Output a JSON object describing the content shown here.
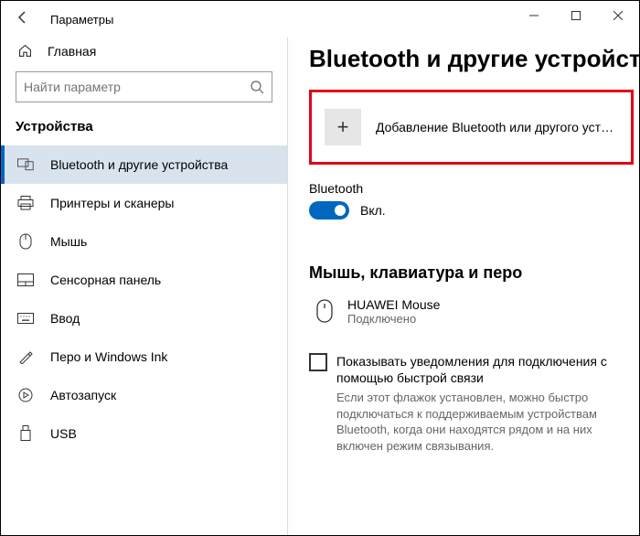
{
  "window": {
    "title": "Параметры"
  },
  "sidebar": {
    "home": "Главная",
    "searchPlaceholder": "Найти параметр",
    "category": "Устройства",
    "items": [
      {
        "label": "Bluetooth и другие устройства"
      },
      {
        "label": "Принтеры и сканеры"
      },
      {
        "label": "Мышь"
      },
      {
        "label": "Сенсорная панель"
      },
      {
        "label": "Ввод"
      },
      {
        "label": "Перо и Windows Ink"
      },
      {
        "label": "Автозапуск"
      },
      {
        "label": "USB"
      }
    ]
  },
  "page": {
    "title": "Bluetooth и другие устройства",
    "addDevice": "Добавление Bluetooth или другого устройс...",
    "btLabel": "Bluetooth",
    "btState": "Вкл.",
    "devicesHeading": "Мышь, клавиатура и перо",
    "device": {
      "name": "HUAWEI  Mouse",
      "status": "Подключено"
    },
    "quickPair": "Показывать уведомления для подключения с помощью быстрой связи",
    "quickPairHint": "Если этот флажок установлен, можно быстро подключаться к поддерживаемым устройствам Bluetooth, когда они находятся рядом и на них включен режим связывания."
  }
}
